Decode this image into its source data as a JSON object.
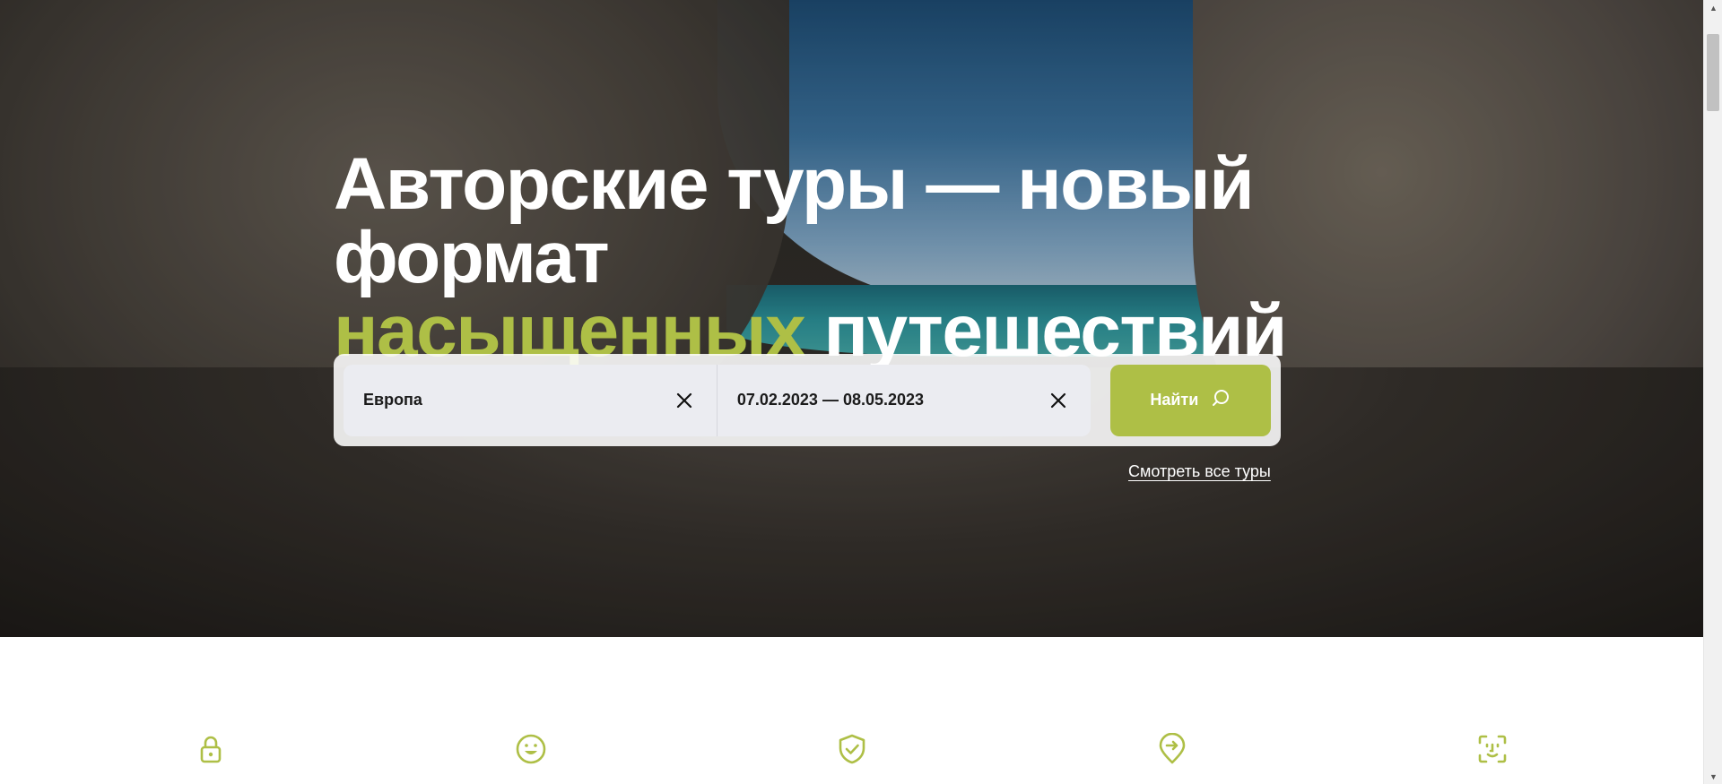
{
  "hero": {
    "headline_line1": "Авторские туры — новый формат",
    "headline_accent": "насыщенных",
    "headline_rest": " путешествий"
  },
  "search": {
    "destination_value": "Европа",
    "dates_value": "07.02.2023 — 08.05.2023",
    "find_label": "Найти"
  },
  "links": {
    "all_tours": "Смотреть все туры"
  },
  "features": {
    "icons": [
      "lock-icon",
      "smile-icon",
      "shield-check-icon",
      "location-arrow-icon",
      "face-id-icon"
    ]
  },
  "colors": {
    "accent": "#aebf46",
    "white": "#ffffff",
    "field_bg": "#ebecf1"
  }
}
